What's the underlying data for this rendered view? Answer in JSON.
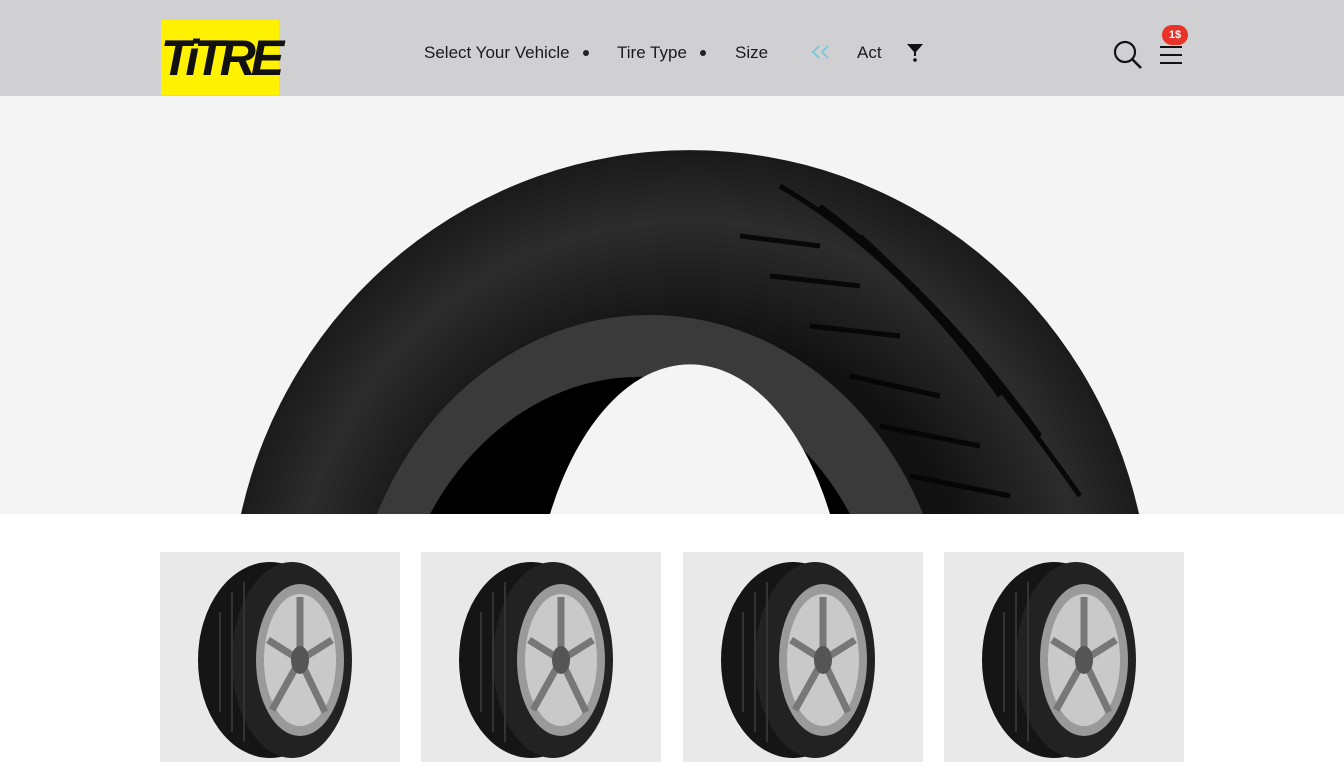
{
  "header": {
    "logo_text": "TiTRE",
    "brand_color": "#fff200",
    "nav": [
      {
        "label": "Select Your Vehicle"
      },
      {
        "label": "Tire Type"
      },
      {
        "label": "Size"
      },
      {
        "label": "Act"
      }
    ],
    "icons": [
      "chevrons-left-icon",
      "filter-icon",
      "search-icon",
      "menu-icon"
    ],
    "cart_badge": "1$",
    "badge_color": "#e8322a",
    "accent_color": "#7fc8d8"
  },
  "hero": {
    "image": "large-tire-tread"
  },
  "products": [
    {
      "image": "tire-with-alloy-wheel"
    },
    {
      "image": "tire-with-alloy-wheel"
    },
    {
      "image": "tire-with-alloy-wheel"
    },
    {
      "image": "tire-with-alloy-wheel"
    }
  ]
}
